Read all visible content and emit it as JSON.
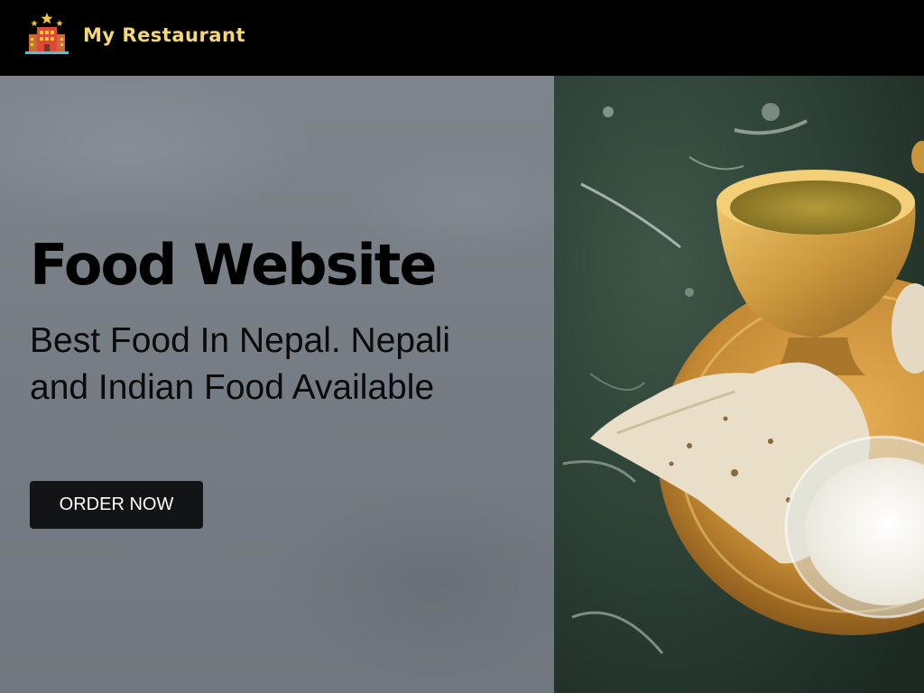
{
  "navbar": {
    "brand": "My Restaurant",
    "logo_icon": "restaurant-building-icon"
  },
  "hero": {
    "title": "Food Website",
    "tagline": "Best Food In Nepal. Nepali and Indian Food Available",
    "cta_label": "ORDER NOW",
    "image": "nepali-thali-food-photo"
  },
  "colors": {
    "navbar_bg": "#000000",
    "brand_text": "#f3d873",
    "hero_panel_bg": "#767d84",
    "button_bg": "#121416",
    "button_text": "#ffffff"
  }
}
